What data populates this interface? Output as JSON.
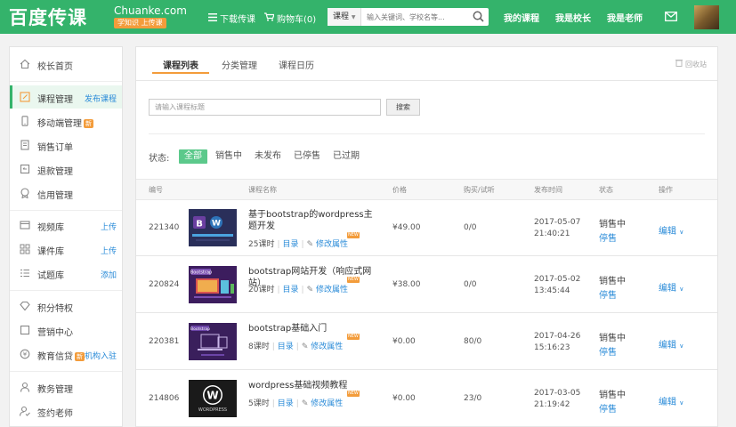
{
  "header": {
    "logo_cn": "百度传课",
    "logo_en": "Chuanke.com",
    "logo_tag": "学知识 上传课",
    "download": "下载传课",
    "cart": "购物车(0)",
    "search_category": "课程",
    "search_placeholder": "输入关键词、学校名等...",
    "my_courses": "我的课程",
    "i_am_principal": "我是校长",
    "i_am_teacher": "我是老师",
    "accent_color": "#34b36b"
  },
  "sidebar": {
    "items": [
      {
        "label": "校长首页",
        "icon": "home-icon"
      },
      {
        "label": "课程管理",
        "action": "发布课程",
        "icon": "edit-icon"
      },
      {
        "label": "移动端管理",
        "badge": "新",
        "icon": "mobile-icon"
      },
      {
        "label": "销售订单",
        "icon": "document-icon"
      },
      {
        "label": "退款管理",
        "icon": "refund-icon"
      },
      {
        "label": "信用管理",
        "icon": "credit-icon"
      },
      {
        "label": "视频库",
        "action": "上传",
        "icon": "video-icon"
      },
      {
        "label": "课件库",
        "action": "上传",
        "icon": "courseware-icon"
      },
      {
        "label": "试题库",
        "action": "添加",
        "icon": "exam-icon"
      },
      {
        "label": "积分特权",
        "icon": "diamond-icon"
      },
      {
        "label": "营销中心",
        "icon": "marketing-icon"
      },
      {
        "label": "教育信贷",
        "badge": "新",
        "action": "机构入驻",
        "icon": "loan-icon"
      },
      {
        "label": "教务管理",
        "icon": "user-icon"
      },
      {
        "label": "签约老师",
        "icon": "teacher-icon"
      }
    ]
  },
  "tabs": [
    "课程列表",
    "分类管理",
    "课程日历"
  ],
  "recycle": "回收站",
  "search": {
    "placeholder": "请输入课程标题",
    "button": "搜索"
  },
  "filter": {
    "label": "状态:",
    "options": [
      "全部",
      "销售中",
      "未发布",
      "已停售",
      "已过期"
    ]
  },
  "table": {
    "headers": [
      "编号",
      "课程名称",
      "价格",
      "购买/试听",
      "发布时间",
      "状态",
      "操作"
    ],
    "rows": [
      {
        "id": "221340",
        "title": "基于bootstrap的wordpress主题开发",
        "lessons": "25课时",
        "catalog": "目录",
        "modify": "修改属性",
        "price": "¥49.00",
        "buy": "0/0",
        "date": "2017-05-07",
        "time": "21:40:21",
        "status": "销售中",
        "stop": "停售",
        "op": "编辑"
      },
      {
        "id": "220824",
        "title": "bootstrap网站开发（响应式网站）",
        "lessons": "20课时",
        "catalog": "目录",
        "modify": "修改属性",
        "price": "¥38.00",
        "buy": "0/0",
        "date": "2017-05-02",
        "time": "13:45:44",
        "status": "销售中",
        "stop": "停售",
        "op": "编辑"
      },
      {
        "id": "220381",
        "title": "bootstrap基础入门",
        "lessons": "8课时",
        "catalog": "目录",
        "modify": "修改属性",
        "price": "¥0.00",
        "buy": "80/0",
        "date": "2017-04-26",
        "time": "15:16:23",
        "status": "销售中",
        "stop": "停售",
        "op": "编辑"
      },
      {
        "id": "214806",
        "title": "wordpress基础视频教程",
        "lessons": "5课时",
        "catalog": "目录",
        "modify": "修改属性",
        "price": "¥0.00",
        "buy": "23/0",
        "date": "2017-03-05",
        "time": "21:19:42",
        "status": "销售中",
        "stop": "停售",
        "op": "编辑"
      }
    ]
  },
  "new_badge": "NEW"
}
